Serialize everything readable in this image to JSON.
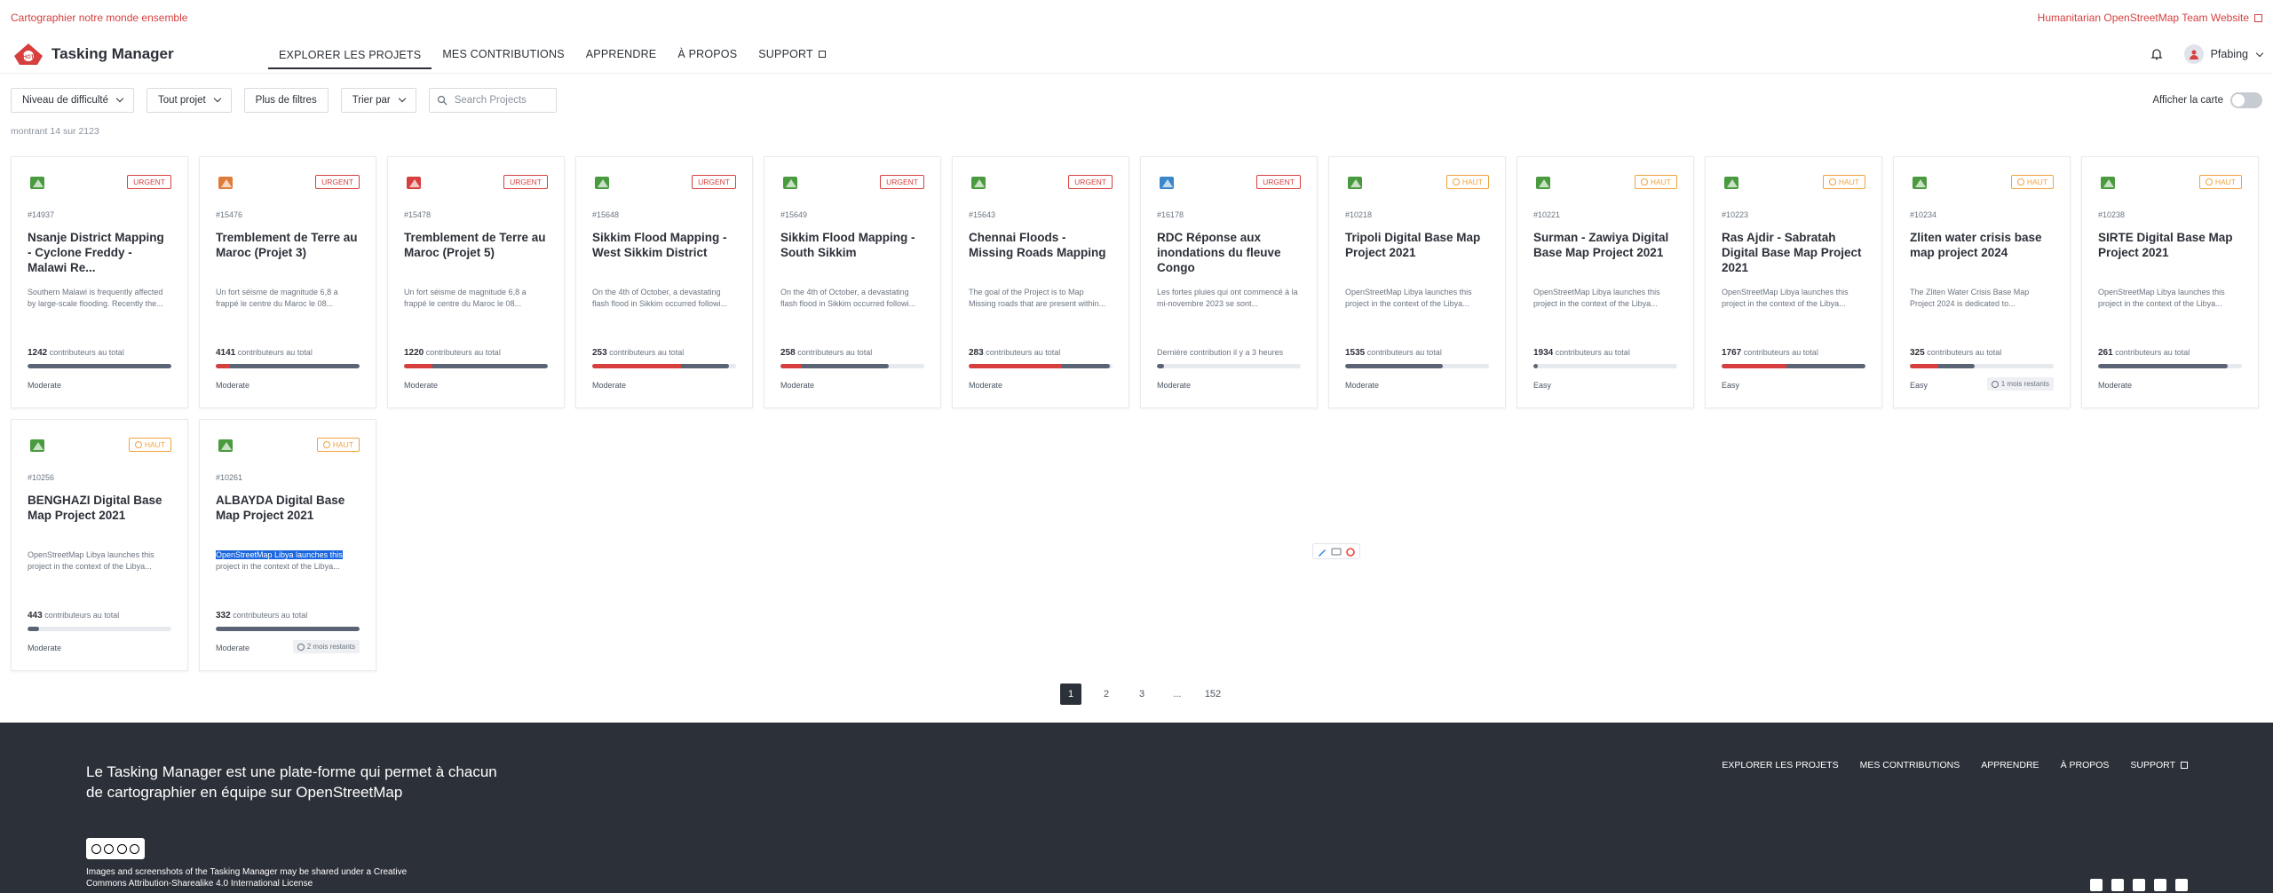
{
  "topbar": {
    "left_text": "Cartographier notre monde ensemble",
    "right_text": "Humanitarian OpenStreetMap Team Website"
  },
  "navbar": {
    "app_title": "Tasking Manager",
    "links": [
      "EXPLORER LES PROJETS",
      "MES CONTRIBUTIONS",
      "APPRENDRE",
      "À PROPOS",
      "SUPPORT"
    ],
    "active_index": 0,
    "username": "Pfabing"
  },
  "filters": {
    "difficulty": "Niveau de difficulté",
    "project_type": "Tout projet",
    "more": "Plus de filtres",
    "sort": "Trier par",
    "search_placeholder": "Search Projects",
    "map_toggle_label": "Afficher la carte"
  },
  "count_text": "montrant 14 sur 2123",
  "contributors_suffix": "contributeurs au total",
  "projects": [
    {
      "id": "#14937",
      "title": "Nsanje District Mapping - Cyclone Freddy - Malawi Re...",
      "desc": "Southern Malawi is frequently affected by large-scale flooding. Recently the...",
      "priority": "URGENT",
      "contributors": "1242",
      "mapped": 1.0,
      "validated": 0.0,
      "difficulty": "Moderate",
      "days_left": ""
    },
    {
      "id": "#15476",
      "title": "Tremblement de Terre au Maroc (Projet 3)",
      "desc": "Un fort séisme de magnitude 6,8 a frappé le centre du Maroc le 08...",
      "priority": "URGENT",
      "contributors": "4141",
      "mapped": 1.0,
      "validated": 0.1,
      "difficulty": "Moderate",
      "days_left": ""
    },
    {
      "id": "#15478",
      "title": "Tremblement de Terre au Maroc (Projet 5)",
      "desc": "Un fort séisme de magnitude 6,8 a frappé le centre du Maroc le 08...",
      "priority": "URGENT",
      "contributors": "1220",
      "mapped": 1.0,
      "validated": 0.2,
      "difficulty": "Moderate",
      "days_left": ""
    },
    {
      "id": "#15648",
      "title": "Sikkim Flood Mapping - West Sikkim District",
      "desc": "On the 4th of October, a devastating flash flood in Sikkim occurred followi...",
      "priority": "URGENT",
      "contributors": "253",
      "mapped": 0.95,
      "validated": 0.62,
      "difficulty": "Moderate",
      "days_left": ""
    },
    {
      "id": "#15649",
      "title": "Sikkim Flood Mapping - South Sikkim",
      "desc": "On the 4th of October, a devastating flash flood in Sikkim occurred followi...",
      "priority": "URGENT",
      "contributors": "258",
      "mapped": 0.75,
      "validated": 0.15,
      "difficulty": "Moderate",
      "days_left": ""
    },
    {
      "id": "#15643",
      "title": "Chennai Floods - Missing Roads Mapping",
      "desc": "The goal of the Project is to Map Missing roads that are present within...",
      "priority": "URGENT",
      "contributors": "283",
      "mapped": 0.98,
      "validated": 0.65,
      "difficulty": "Moderate",
      "days_left": ""
    },
    {
      "id": "#16178",
      "title": "RDC Réponse aux inondations du fleuve Congo",
      "desc": "Les fortes pluies qui ont commencé à la mi-novembre 2023 se sont...",
      "priority": "URGENT",
      "contributors": "Dernière contribution il y a 3 heures",
      "mapped": 0.05,
      "validated": 0.0,
      "difficulty": "Moderate",
      "days_left": "",
      "last_contrib": true
    },
    {
      "id": "#10218",
      "title": "Tripoli Digital Base Map Project 2021",
      "desc": "OpenStreetMap Libya launches this project in the context of the Libya...",
      "priority": "HAUT",
      "contributors": "1535",
      "mapped": 0.68,
      "validated": 0.0,
      "difficulty": "Moderate",
      "days_left": ""
    },
    {
      "id": "#10221",
      "title": "Surman - Zawiya Digital Base Map Project 2021",
      "desc": "OpenStreetMap Libya launches this project in the context of the Libya...",
      "priority": "HAUT",
      "contributors": "1934",
      "mapped": 0.03,
      "validated": 0.0,
      "difficulty": "Easy",
      "days_left": ""
    },
    {
      "id": "#10223",
      "title": "Ras Ajdir - Sabratah Digital Base Map Project 2021",
      "desc": "OpenStreetMap Libya launches this project in the context of the Libya...",
      "priority": "HAUT",
      "contributors": "1767",
      "mapped": 1.0,
      "validated": 0.45,
      "difficulty": "Easy",
      "days_left": ""
    },
    {
      "id": "#10234",
      "title": "Zliten water crisis base map project 2024",
      "desc": "The Zliten Water Crisis Base Map Project 2024 is dedicated to...",
      "priority": "HAUT",
      "contributors": "325",
      "mapped": 0.45,
      "validated": 0.2,
      "difficulty": "Easy",
      "days_left": "1 mois restants"
    },
    {
      "id": "#10238",
      "title": "SIRTE Digital Base Map Project 2021",
      "desc": "OpenStreetMap Libya launches this project in the context of the Libya...",
      "priority": "HAUT",
      "contributors": "261",
      "mapped": 0.9,
      "validated": 0.0,
      "difficulty": "Moderate",
      "days_left": ""
    },
    {
      "id": "#10256",
      "title": "BENGHAZI Digital Base Map Project 2021",
      "desc": "OpenStreetMap Libya launches this project in the context of the Libya...",
      "priority": "HAUT",
      "contributors": "443",
      "mapped": 0.08,
      "validated": 0.0,
      "difficulty": "Moderate",
      "days_left": ""
    },
    {
      "id": "#10261",
      "title": "ALBAYDA Digital Base Map Project 2021",
      "desc": "OpenStreetMap Libya launches this project in the context of the Libya...",
      "desc_highlight": "OpenStreetMap Libya launches this",
      "desc_rest": "project in the context of the Libya...",
      "priority": "HAUT",
      "contributors": "332",
      "mapped": 1.0,
      "validated": 0.0,
      "difficulty": "Moderate",
      "days_left": "2 mois restants"
    }
  ],
  "pagination": {
    "pages": [
      "1",
      "2",
      "3",
      "...",
      "152"
    ],
    "current": "1"
  },
  "footer": {
    "tagline": "Le Tasking Manager est une plate-forme qui permet à chacun de cartographier en équipe sur OpenStreetMap",
    "links": [
      "EXPLORER LES PROJETS",
      "MES CONTRIBUTIONS",
      "APPRENDRE",
      "À PROPOS",
      "SUPPORT"
    ],
    "license": "Images and screenshots of the Tasking Manager may be shared under a Creative Commons Attribution-Sharealike 4.0 International License",
    "social": [
      "twitter-icon",
      "facebook-icon",
      "youtube-icon",
      "instagram-icon",
      "github-icon"
    ]
  },
  "colors": {
    "accent": "#d73f3f",
    "dark": "#2c3038",
    "high": "#f0a33c"
  }
}
